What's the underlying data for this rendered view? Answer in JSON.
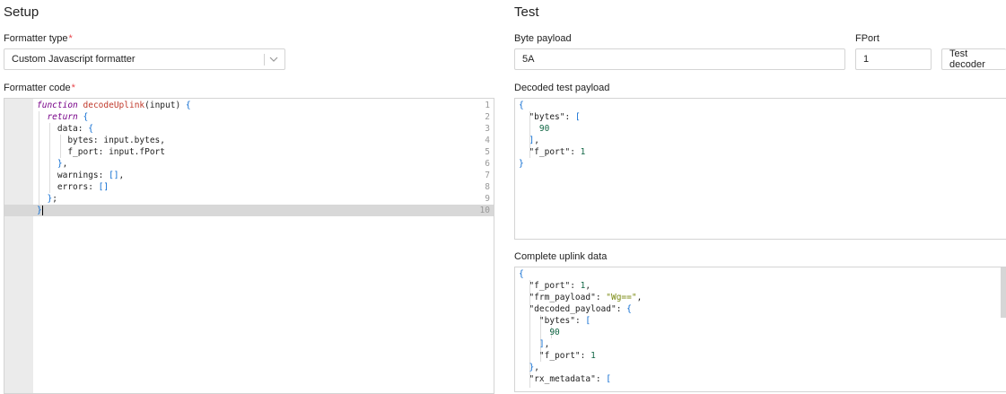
{
  "setup": {
    "title": "Setup",
    "formatter_type_label": "Formatter type",
    "required_mark": "*",
    "formatter_type_value": "Custom Javascript formatter",
    "formatter_code_label": "Formatter code",
    "code_lines": [
      {
        "n": "1",
        "text": "function decodeUplink(input) {"
      },
      {
        "n": "2",
        "text": "  return {"
      },
      {
        "n": "3",
        "text": "    data: {"
      },
      {
        "n": "4",
        "text": "      bytes: input.bytes,"
      },
      {
        "n": "5",
        "text": "      f_port: input.fPort"
      },
      {
        "n": "6",
        "text": "    },"
      },
      {
        "n": "7",
        "text": "    warnings: [],"
      },
      {
        "n": "8",
        "text": "    errors: []"
      },
      {
        "n": "9",
        "text": "  };"
      },
      {
        "n": "10",
        "text": "}"
      }
    ]
  },
  "test": {
    "title": "Test",
    "byte_payload_label": "Byte payload",
    "byte_payload_value": "5A",
    "fport_label": "FPort",
    "fport_value": "1",
    "test_decoder_button": "Test decoder",
    "decoded_label": "Decoded test payload",
    "complete_label": "Complete uplink data"
  },
  "colors": {
    "required": "#e8474d",
    "keyword": "#770088",
    "function_name": "#c0392b",
    "number": "#116644",
    "string": "#7a8a11",
    "bracket": "#0a6ad1"
  }
}
